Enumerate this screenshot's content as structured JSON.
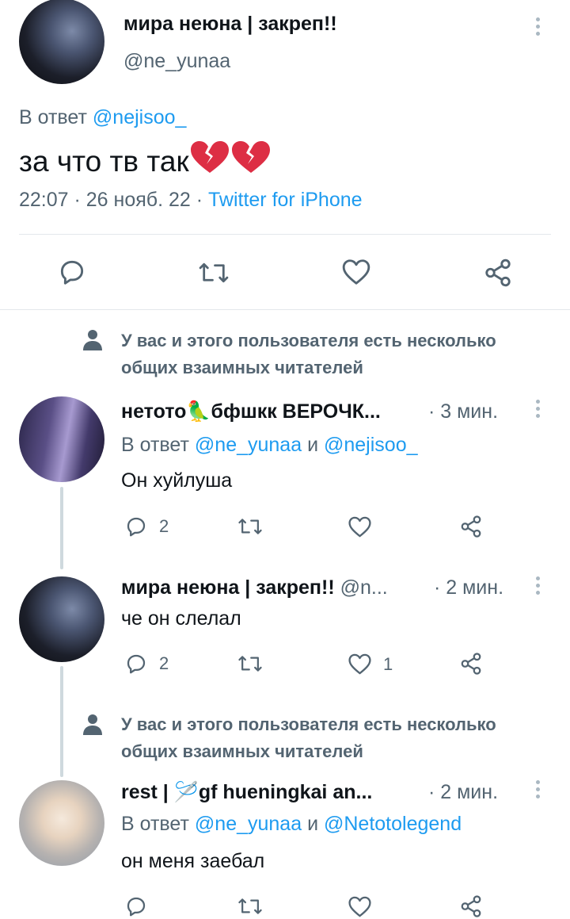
{
  "main_tweet": {
    "display_name": "мира неюна | закреп!!",
    "handle": "@ne_yunaa",
    "reply_prefix": "В ответ",
    "reply_to": "@nejisoo_",
    "text": "за что тв так",
    "emojis": [
      "broken-heart",
      "broken-heart"
    ],
    "timestamp": "22:07 · 26 нояб. 22 · ",
    "source": "Twitter for iPhone"
  },
  "mutual_notice": "У вас и этого пользователя есть несколько общих взаимных читателей",
  "replies": [
    {
      "display_name": "нетото🦜бфшкк ВЕРОЧК...",
      "time": "· 3 мин.",
      "reply_prefix": "В ответ",
      "reply_to_1": "@ne_yunaa",
      "and": "и",
      "reply_to_2": "@nejisoo_",
      "text": "Он хуйлуша",
      "reply_count": "2",
      "like_count": ""
    },
    {
      "display_name": "мира неюна | закреп!!",
      "handle": "@n...",
      "time": "· 2 мин.",
      "text": "че он слелал",
      "reply_count": "2",
      "like_count": "1"
    },
    {
      "display_name": "rest | 🪡gf hueningkai an...",
      "time": "· 2 мин.",
      "reply_prefix": "В ответ",
      "reply_to_1": "@ne_yunaa",
      "and": "и",
      "reply_to_2": "@Netotolegend",
      "text": "он меня заебал"
    }
  ],
  "colors": {
    "accent": "#1d9bf0",
    "secondary_text": "#536471",
    "broken_heart": "#dd2e44"
  }
}
